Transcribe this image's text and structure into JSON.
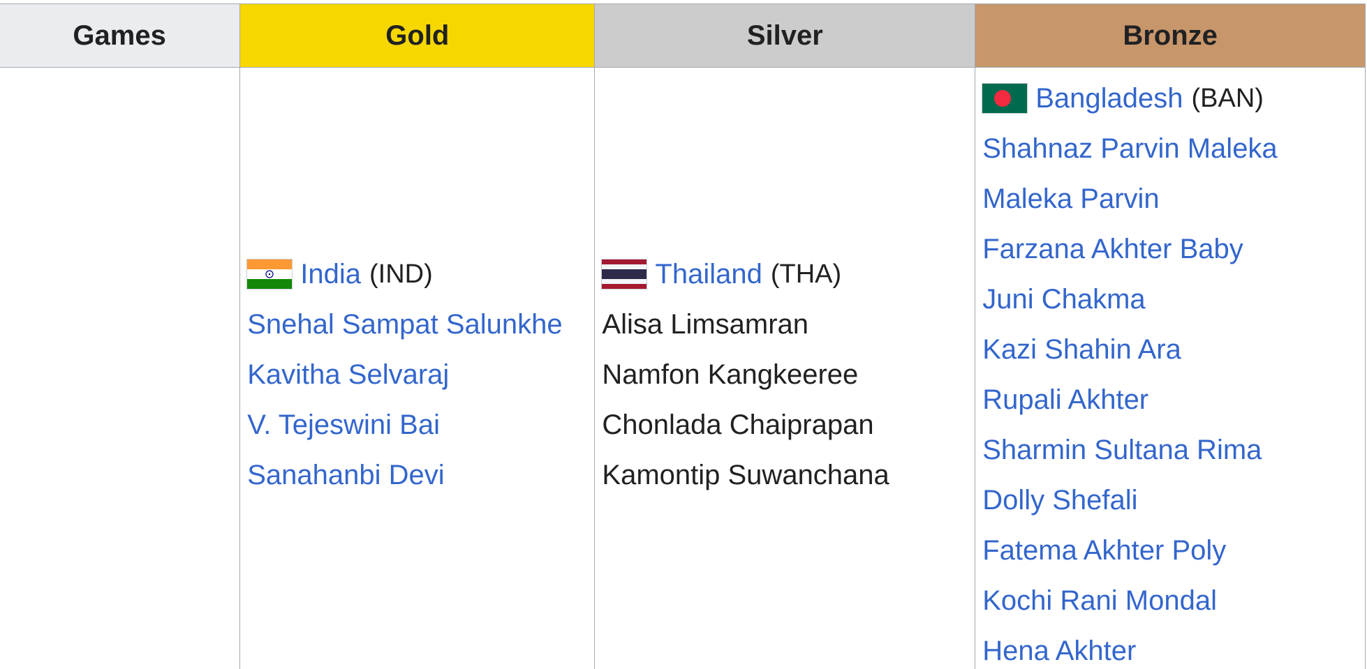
{
  "headers": {
    "games": "Games",
    "gold": "Gold",
    "silver": "Silver",
    "bronze": "Bronze"
  },
  "colors": {
    "gold_header": "#f7d700",
    "silver_header": "#cccccc",
    "bronze_header": "#c8966b",
    "games_header": "#eaecf0",
    "link": "#3366cc",
    "text": "#202122"
  },
  "gold": {
    "country": "India",
    "code": "(IND)",
    "flag_icon": "india-flag-icon",
    "athletes": [
      "Snehal Sampat Salunkhe",
      "Kavitha Selvaraj",
      "V. Tejeswini Bai",
      "Sanahanbi Devi"
    ]
  },
  "silver": {
    "country": "Thailand",
    "code": "(THA)",
    "flag_icon": "thailand-flag-icon",
    "athletes": [
      "Alisa Limsamran",
      "Namfon Kangkeeree",
      "Chonlada Chaiprapan",
      "Kamontip Suwanchana"
    ]
  },
  "bronze": {
    "country": "Bangladesh",
    "code": "(BAN)",
    "flag_icon": "bangladesh-flag-icon",
    "athletes": [
      "Shahnaz Parvin Maleka",
      "Maleka Parvin",
      "Farzana Akhter Baby",
      "Juni Chakma",
      "Kazi Shahin Ara",
      "Rupali Akhter",
      "Sharmin Sultana Rima",
      "Dolly Shefali",
      "Fatema Akhter Poly",
      "Kochi Rani Mondal",
      "Hena Akhter"
    ]
  }
}
